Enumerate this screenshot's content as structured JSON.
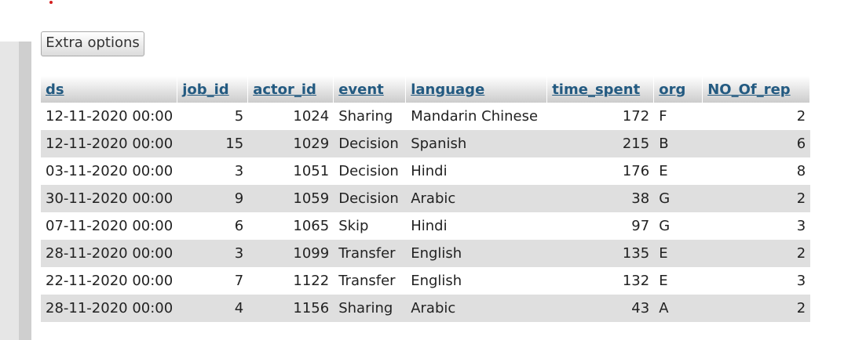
{
  "toolbar": {
    "extra_options_label": "Extra options"
  },
  "table": {
    "columns": [
      {
        "key": "ds",
        "label": "ds"
      },
      {
        "key": "job_id",
        "label": "job_id"
      },
      {
        "key": "actor_id",
        "label": "actor_id"
      },
      {
        "key": "event",
        "label": "event"
      },
      {
        "key": "language",
        "label": "language"
      },
      {
        "key": "time_spent",
        "label": "time_spent"
      },
      {
        "key": "org",
        "label": "org"
      },
      {
        "key": "NO_Of_rep",
        "label": "NO_Of_rep"
      }
    ],
    "rows": [
      {
        "ds": "12-11-2020 00:00",
        "job_id": "5",
        "actor_id": "1024",
        "event": "Sharing",
        "language": "Mandarin Chinese",
        "time_spent": "172",
        "org": "F",
        "NO_Of_rep": "2"
      },
      {
        "ds": "12-11-2020 00:00",
        "job_id": "15",
        "actor_id": "1029",
        "event": "Decision",
        "language": "Spanish",
        "time_spent": "215",
        "org": "B",
        "NO_Of_rep": "6"
      },
      {
        "ds": "03-11-2020 00:00",
        "job_id": "3",
        "actor_id": "1051",
        "event": "Decision",
        "language": "Hindi",
        "time_spent": "176",
        "org": "E",
        "NO_Of_rep": "8"
      },
      {
        "ds": "30-11-2020 00:00",
        "job_id": "9",
        "actor_id": "1059",
        "event": "Decision",
        "language": "Arabic",
        "time_spent": "38",
        "org": "G",
        "NO_Of_rep": "2"
      },
      {
        "ds": "07-11-2020 00:00",
        "job_id": "6",
        "actor_id": "1065",
        "event": "Skip",
        "language": "Hindi",
        "time_spent": "97",
        "org": "G",
        "NO_Of_rep": "3"
      },
      {
        "ds": "28-11-2020 00:00",
        "job_id": "3",
        "actor_id": "1099",
        "event": "Transfer",
        "language": "English",
        "time_spent": "135",
        "org": "E",
        "NO_Of_rep": "2"
      },
      {
        "ds": "22-11-2020 00:00",
        "job_id": "7",
        "actor_id": "1122",
        "event": "Transfer",
        "language": "English",
        "time_spent": "132",
        "org": "E",
        "NO_Of_rep": "3"
      },
      {
        "ds": "28-11-2020 00:00",
        "job_id": "4",
        "actor_id": "1156",
        "event": "Sharing",
        "language": "Arabic",
        "time_spent": "43",
        "org": "A",
        "NO_Of_rep": "2"
      }
    ]
  },
  "colors": {
    "header_text": "#235a81",
    "row_alt": "#dfdfdf",
    "indicator": "#d42020"
  }
}
